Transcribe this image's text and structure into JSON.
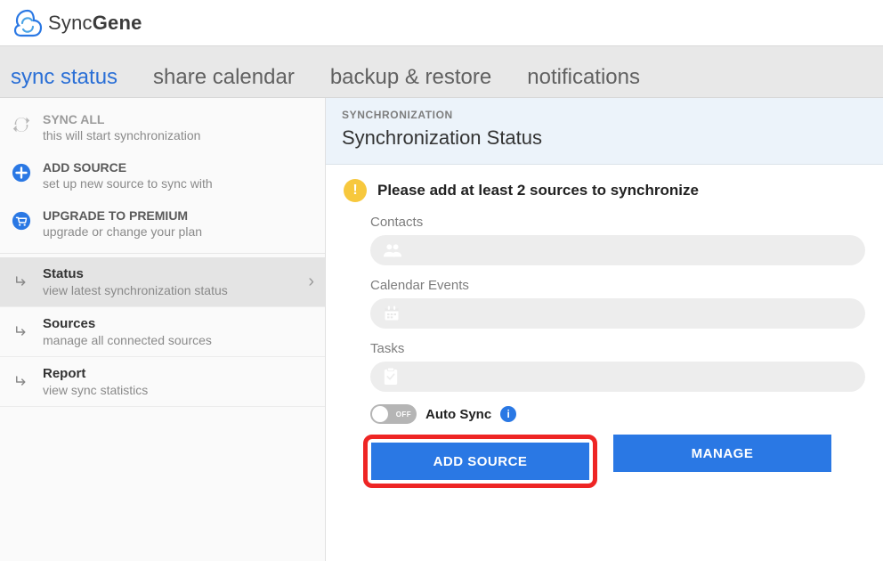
{
  "brand": {
    "part1": "Sync",
    "part2": "Gene"
  },
  "tabs": [
    {
      "label": "sync status",
      "active": true
    },
    {
      "label": "share calendar",
      "active": false
    },
    {
      "label": "backup & restore",
      "active": false
    },
    {
      "label": "notifications",
      "active": false
    }
  ],
  "sidebar": {
    "actions": [
      {
        "id": "sync-all",
        "title": "SYNC ALL",
        "desc": "this will start synchronization",
        "icon": "sync",
        "disabled": true
      },
      {
        "id": "add-source",
        "title": "ADD SOURCE",
        "desc": "set up new source to sync with",
        "icon": "plus",
        "disabled": false
      },
      {
        "id": "upgrade",
        "title": "UPGRADE TO PREMIUM",
        "desc": "upgrade or change your plan",
        "icon": "cart",
        "disabled": false
      }
    ],
    "nav": [
      {
        "id": "status",
        "title": "Status",
        "desc": "view latest synchronization status",
        "active": true
      },
      {
        "id": "sources",
        "title": "Sources",
        "desc": "manage all connected sources",
        "active": false
      },
      {
        "id": "report",
        "title": "Report",
        "desc": "view sync statistics",
        "active": false
      }
    ]
  },
  "content": {
    "eyebrow": "SYNCHRONIZATION",
    "title": "Synchronization Status",
    "alert": "Please add at least 2 sources to synchronize",
    "categories": [
      {
        "id": "contacts",
        "label": "Contacts",
        "icon": "people"
      },
      {
        "id": "calendar",
        "label": "Calendar Events",
        "icon": "calendar"
      },
      {
        "id": "tasks",
        "label": "Tasks",
        "icon": "clipboard"
      }
    ],
    "autosync": {
      "label": "Auto Sync",
      "toggle_label": "OFF",
      "state": false
    },
    "buttons": {
      "add_source": "ADD SOURCE",
      "manage": "MANAGE"
    }
  }
}
